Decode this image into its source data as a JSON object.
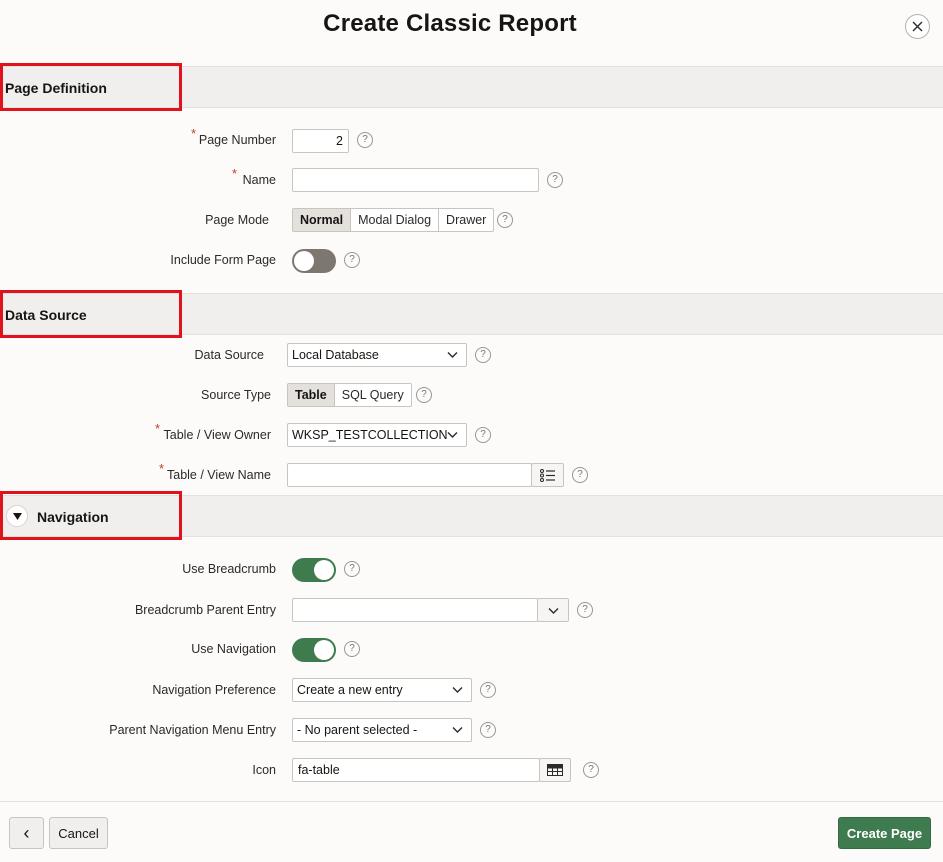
{
  "dialog": {
    "title": "Create Classic Report",
    "close_label": "×"
  },
  "colors": {
    "accent": "#3e7b4e",
    "highlight": "#e0131d",
    "required": "#c23a2b"
  },
  "page_definition": {
    "title": "Page Definition",
    "page_number": {
      "label": "Page Number",
      "value": "2",
      "required": true
    },
    "name": {
      "label": "Name",
      "value": "",
      "required": true
    },
    "page_mode": {
      "label": "Page Mode",
      "options": [
        "Normal",
        "Modal Dialog",
        "Drawer"
      ],
      "selected": "Normal"
    },
    "include_form_page": {
      "label": "Include Form Page",
      "on": false
    }
  },
  "data_source": {
    "title": "Data Source",
    "source": {
      "label": "Data Source",
      "value": "Local Database"
    },
    "source_type": {
      "label": "Source Type",
      "options": [
        "Table",
        "SQL Query"
      ],
      "selected": "Table"
    },
    "owner": {
      "label": "Table / View Owner",
      "value": "WKSP_TESTCOLLECTION",
      "required": true
    },
    "view_name": {
      "label": "Table / View Name",
      "value": "",
      "required": true
    }
  },
  "navigation": {
    "title": "Navigation",
    "use_breadcrumb": {
      "label": "Use Breadcrumb",
      "on": true
    },
    "breadcrumb_parent": {
      "label": "Breadcrumb Parent Entry",
      "value": ""
    },
    "use_navigation": {
      "label": "Use Navigation",
      "on": true
    },
    "nav_preference": {
      "label": "Navigation Preference",
      "value": "Create a new entry"
    },
    "parent_menu": {
      "label": "Parent Navigation Menu Entry",
      "value": "- No parent selected -"
    },
    "icon": {
      "label": "Icon",
      "value": "fa-table"
    }
  },
  "footer": {
    "back_label": "‹",
    "cancel_label": "Cancel",
    "create_label": "Create Page"
  },
  "help_glyph": "?"
}
